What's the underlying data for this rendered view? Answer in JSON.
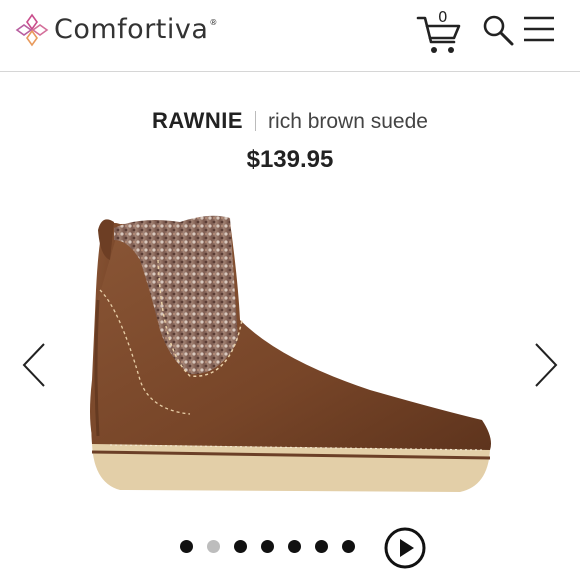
{
  "header": {
    "brand": "Comfortiva",
    "trademark": "®",
    "cart_count": "0",
    "icons": [
      "logo-flower-icon",
      "cart-icon",
      "search-icon",
      "menu-icon"
    ]
  },
  "product": {
    "name": "RAWNIE",
    "color": "rich brown suede",
    "price": "$139.95"
  },
  "carousel": {
    "slide_count": 7,
    "active_index": 1,
    "icons": [
      "chevron-left-icon",
      "chevron-right-icon",
      "play-icon"
    ]
  },
  "colors": {
    "text": "#222222",
    "divider": "#d6d6d6",
    "logo_pink": "#c94d8c",
    "logo_orange": "#e89a5c",
    "suede": "#7a4a2e",
    "sole": "#e3cfa8"
  }
}
